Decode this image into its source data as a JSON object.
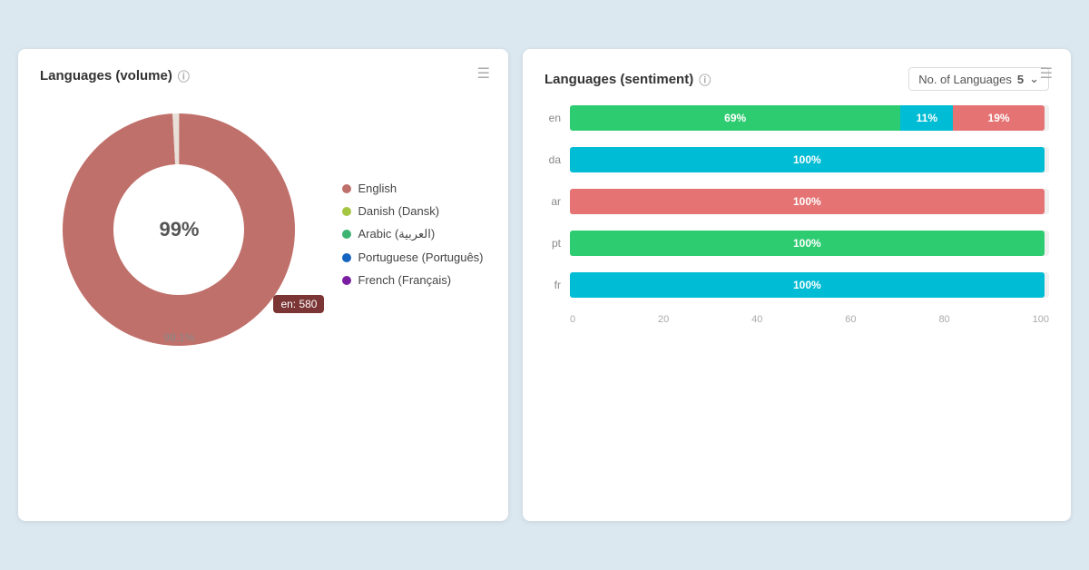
{
  "leftCard": {
    "title": "Languages (volume)",
    "centerLabel": "99%",
    "tooltipLabel": "en: 580",
    "bottomLabel": "99.1%",
    "legend": [
      {
        "label": "English",
        "color": "#c0706a"
      },
      {
        "label": "Danish (Dansk)",
        "color": "#a5c642"
      },
      {
        "label": "Arabic (العربية)",
        "color": "#3cb371"
      },
      {
        "label": "Portuguese (Português)",
        "color": "#1565c0"
      },
      {
        "label": "French (Français)",
        "color": "#7b1fa2"
      }
    ],
    "donut": {
      "mainColor": "#c0706a",
      "mainPercent": 99.1,
      "sliceColor": "#e8e0d8",
      "slicePercent": 0.9
    }
  },
  "rightCard": {
    "title": "Languages (sentiment)",
    "noOfLanguagesLabel": "No. of Languages",
    "noOfLanguagesValue": "5",
    "bars": [
      {
        "lang": "en",
        "segments": [
          {
            "pct": 69,
            "color": "green",
            "label": "69%"
          },
          {
            "pct": 11,
            "color": "cyan",
            "label": "11%"
          },
          {
            "pct": 19,
            "color": "red",
            "label": "19%"
          }
        ]
      },
      {
        "lang": "da",
        "segments": [
          {
            "pct": 99,
            "color": "cyan",
            "label": "100%"
          }
        ]
      },
      {
        "lang": "ar",
        "segments": [
          {
            "pct": 99,
            "color": "red",
            "label": "100%"
          }
        ]
      },
      {
        "lang": "pt",
        "segments": [
          {
            "pct": 99,
            "color": "green",
            "label": "100%"
          }
        ]
      },
      {
        "lang": "fr",
        "segments": [
          {
            "pct": 99,
            "color": "cyan",
            "label": "100%"
          }
        ]
      }
    ],
    "xAxis": [
      "0",
      "20",
      "40",
      "60",
      "80",
      "100"
    ]
  }
}
